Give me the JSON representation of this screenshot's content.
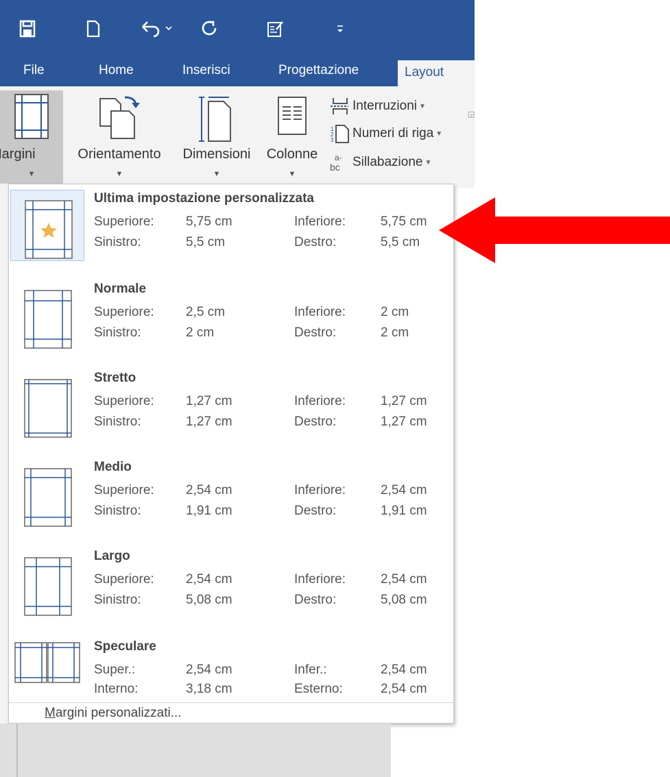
{
  "quick_access": {
    "icons": [
      "save-icon",
      "new-document-icon",
      "undo-icon",
      "redo-icon",
      "form-icon",
      "customize-qat-icon"
    ]
  },
  "ribbon": {
    "tabs": [
      {
        "label": "File"
      },
      {
        "label": "Home"
      },
      {
        "label": "Inserisci"
      },
      {
        "label": "Progettazione"
      },
      {
        "label": "Layout"
      }
    ],
    "active_tab": "Layout",
    "buttons": {
      "margini": "Margini",
      "orientamento": "Orientamento",
      "dimensioni": "Dimensioni",
      "colonne": "Colonne",
      "interruzioni": "Interruzioni",
      "numeri_di_riga": "Numeri di riga",
      "sillabazione": "Sillabazione"
    }
  },
  "dropdown": {
    "presets": [
      {
        "title": "Ultima impostazione personalizzata",
        "row1": {
          "label_a": "Superiore:",
          "value_a": "5,75 cm",
          "label_b": "Inferiore:",
          "value_b": "5,75 cm"
        },
        "row2": {
          "label_a": "Sinistro:",
          "value_a": "5,5 cm",
          "label_b": "Destro:",
          "value_b": "5,5 cm"
        }
      },
      {
        "title": "Normale",
        "row1": {
          "label_a": "Superiore:",
          "value_a": "2,5 cm",
          "label_b": "Inferiore:",
          "value_b": "2 cm"
        },
        "row2": {
          "label_a": "Sinistro:",
          "value_a": "2 cm",
          "label_b": "Destro:",
          "value_b": "2 cm"
        }
      },
      {
        "title": "Stretto",
        "row1": {
          "label_a": "Superiore:",
          "value_a": "1,27 cm",
          "label_b": "Inferiore:",
          "value_b": "1,27 cm"
        },
        "row2": {
          "label_a": "Sinistro:",
          "value_a": "1,27 cm",
          "label_b": "Destro:",
          "value_b": "1,27 cm"
        }
      },
      {
        "title": "Medio",
        "row1": {
          "label_a": "Superiore:",
          "value_a": "2,54 cm",
          "label_b": "Inferiore:",
          "value_b": "2,54 cm"
        },
        "row2": {
          "label_a": "Sinistro:",
          "value_a": "1,91 cm",
          "label_b": "Destro:",
          "value_b": "1,91 cm"
        }
      },
      {
        "title": "Largo",
        "row1": {
          "label_a": "Superiore:",
          "value_a": "2,54 cm",
          "label_b": "Inferiore:",
          "value_b": "2,54 cm"
        },
        "row2": {
          "label_a": "Sinistro:",
          "value_a": "5,08 cm",
          "label_b": "Destro:",
          "value_b": "5,08 cm"
        }
      },
      {
        "title": "Speculare",
        "row1": {
          "label_a": "Super.:",
          "value_a": "2,54 cm",
          "label_b": "Infer.:",
          "value_b": "2,54 cm"
        },
        "row2": {
          "label_a": "Interno:",
          "value_a": "3,18 cm",
          "label_b": "Esterno:",
          "value_b": "2,54 cm"
        }
      }
    ],
    "custom_margins": {
      "accel": "M",
      "rest": "argini personalizzati..."
    }
  },
  "annotation": {
    "arrow_color": "#ff0000"
  },
  "colors": {
    "ribbon_blue": "#2b579a",
    "margin_line": "#2b579a",
    "star": "#f0b44a"
  }
}
